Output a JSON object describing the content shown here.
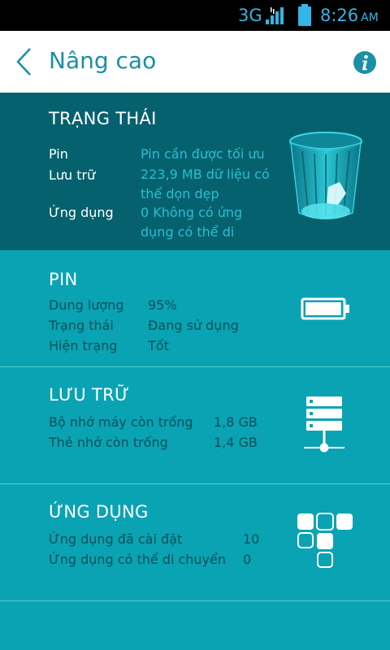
{
  "status_bar": {
    "network": "3G",
    "time": "8:26",
    "ampm": "AM"
  },
  "action_bar": {
    "title": "Nâng cao",
    "back_icon": "chevron-left-icon",
    "info_icon": "info-icon"
  },
  "status_section": {
    "title": "TRẠNG THÁI",
    "rows": [
      {
        "label": "Pin",
        "value": "Pin cần được tối ưu"
      },
      {
        "label": "Lưu trữ",
        "value": "223,9 MB dữ liệu có thể dọn dẹp"
      },
      {
        "label": "Ứng dụng",
        "value": "0 Không có ứng dụng có thể di"
      }
    ],
    "icon": "trash-bin-icon"
  },
  "battery_section": {
    "title": "PIN",
    "rows": [
      {
        "label": "Dung lượng",
        "value": "95%"
      },
      {
        "label": "Trạng thái",
        "value": "Đang sử dụng"
      },
      {
        "label": "Hiện trạng",
        "value": "Tốt"
      }
    ],
    "level": 0.95,
    "icon": "battery-icon"
  },
  "storage_section": {
    "title": "LƯU TRỮ",
    "rows": [
      {
        "label": "Bộ nhớ máy còn trống",
        "value": "1,8 GB"
      },
      {
        "label": "Thẻ nhớ còn trống",
        "value": "1,4 GB"
      }
    ],
    "icon": "server-storage-icon"
  },
  "apps_section": {
    "title": "ỨNG DỤNG",
    "rows": [
      {
        "label": "Ứng dụng đã cài đặt",
        "value": "10"
      },
      {
        "label": "Ứng dụng có thể di chuyển",
        "value": "0"
      }
    ],
    "icon": "app-grid-icon"
  },
  "colors": {
    "status_bar": "#000000",
    "accent": "#33b5e5",
    "title_teal": "#1a8fa5",
    "status_section_bg": "#06616e",
    "content_bg": "#0aa3b3",
    "dark_text": "#05505a"
  }
}
